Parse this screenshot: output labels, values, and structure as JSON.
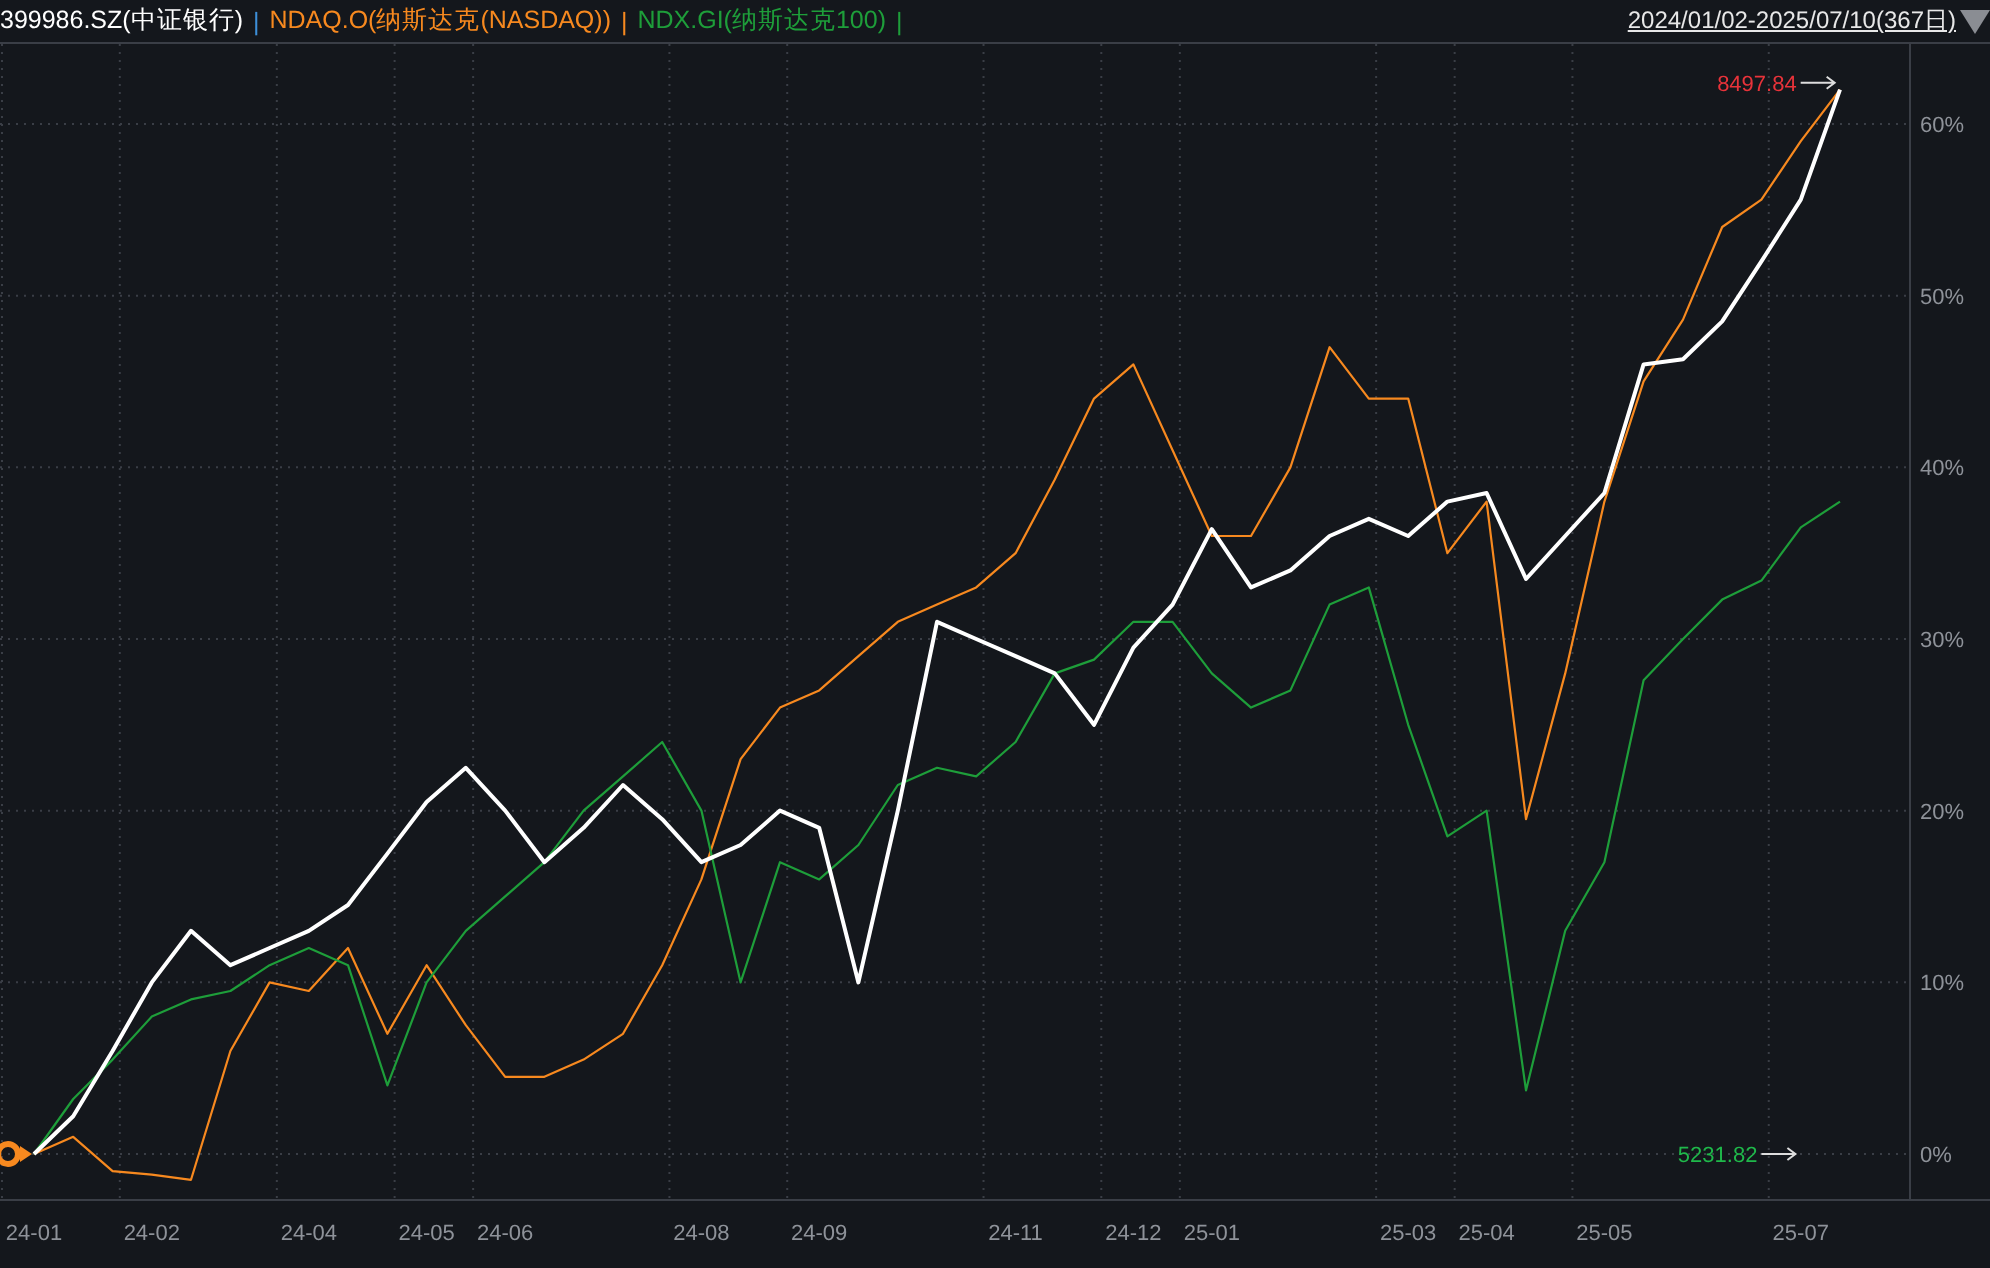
{
  "legend_separators": [
    {
      "text": "|",
      "color": "#3d8fd9"
    },
    {
      "text": "|",
      "color": "#f7891f"
    },
    {
      "text": "|",
      "color": "#1e9e3a"
    }
  ],
  "date_range": "2024/01/02-2025/07/10(367日)",
  "chart": {
    "chart_data": {
      "type": "line",
      "categories": [
        "24-01",
        null,
        null,
        "24-02",
        null,
        null,
        null,
        "24-04",
        null,
        null,
        "24-05",
        null,
        "24-06",
        null,
        null,
        null,
        null,
        "24-08",
        null,
        null,
        "24-09",
        null,
        null,
        null,
        null,
        "24-11",
        null,
        null,
        "24-12",
        null,
        "25-01",
        null,
        null,
        null,
        null,
        "25-03",
        null,
        "25-04",
        null,
        null,
        "25-05",
        null,
        null,
        null,
        null,
        "25-07",
        null
      ],
      "series": [
        {
          "name": "399986.SZ(中证银行)",
          "color": "#ffffff",
          "values": [
            0,
            2.2,
            6,
            10,
            13,
            11,
            12,
            13,
            14.5,
            17.5,
            20.5,
            22.5,
            20,
            17,
            19,
            21.5,
            19.5,
            17,
            18,
            20,
            19,
            10,
            20,
            31,
            30,
            29,
            28,
            25,
            29.5,
            32,
            36.4,
            33,
            34,
            36,
            37,
            36,
            38,
            38.5,
            33.5,
            36,
            38.5,
            46,
            46.3,
            48.5,
            52,
            55.6,
            62
          ]
        },
        {
          "name": "NDAQ.O(纳斯达克(NASDAQ))",
          "color": "#f7891f",
          "values": [
            0,
            1,
            -1,
            -1.2,
            -1.5,
            6,
            10,
            9.5,
            12,
            7,
            11,
            7.5,
            4.5,
            4.5,
            5.5,
            7,
            11,
            16,
            23,
            26,
            27,
            29,
            31,
            32,
            33,
            35,
            39.3,
            44,
            46,
            41,
            36,
            36,
            40,
            47,
            44,
            44,
            35,
            38,
            19.5,
            28,
            38,
            45,
            48.6,
            54,
            55.6,
            59,
            62
          ]
        },
        {
          "name": "NDX.GI(纳斯达克100)",
          "color": "#1e9e3a",
          "values": [
            0,
            3.2,
            5.5,
            8,
            9,
            9.5,
            11,
            12,
            11,
            4,
            10,
            13,
            15,
            17,
            20,
            22,
            24,
            20,
            10,
            17,
            16,
            18,
            21.5,
            22.5,
            22,
            24,
            28,
            28.8,
            31,
            31,
            28,
            26,
            27,
            32,
            33,
            25,
            18.5,
            20,
            3.7,
            13,
            17,
            27.6,
            30,
            32.3,
            33.4,
            36.5,
            38
          ]
        }
      ],
      "ylim": [
        -2.68,
        64.66
      ],
      "grid": true,
      "yticks": [
        {
          "value": 0,
          "label": "0%"
        },
        {
          "value": 10,
          "label": "10%"
        },
        {
          "value": 20,
          "label": "20%"
        },
        {
          "value": 30,
          "label": "30%"
        },
        {
          "value": 40,
          "label": "40%"
        },
        {
          "value": 50,
          "label": "50%"
        },
        {
          "value": 60,
          "label": "60%"
        }
      ]
    },
    "value_tags": [
      {
        "text": "8497.84",
        "color": "#e8333a"
      },
      {
        "text": "5231.82",
        "color": "#1fb84a"
      }
    ]
  }
}
